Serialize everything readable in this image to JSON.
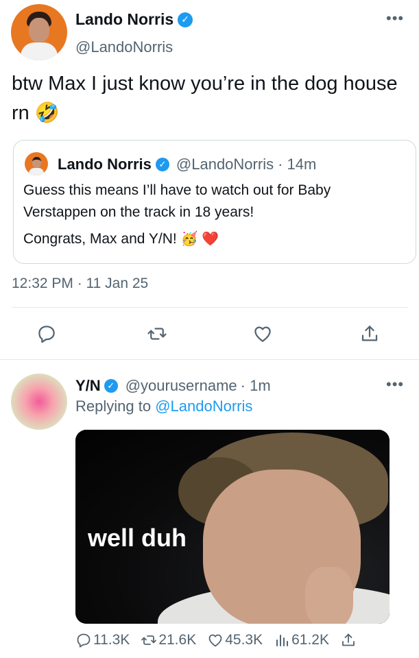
{
  "main_tweet": {
    "author_name": "Lando Norris",
    "author_handle": "@LandoNorris",
    "text": "btw Max I just know you’re in the dog house rn 🤣",
    "timestamp": "12:32 PM · 11 Jan 25"
  },
  "quoted_tweet": {
    "author_name": "Lando Norris",
    "author_handle": "@LandoNorris",
    "age": "· 14m",
    "line1": "Guess this means I’ll have to watch out for Baby Verstappen on the track in 18 years!",
    "line2": "Congrats, Max and Y/N!",
    "emojis": "🥳 ❤️"
  },
  "reply_tweet": {
    "author_name": "Y/N",
    "author_handle": "@yourusername",
    "age": "· 1m",
    "replying_prefix": "Replying to",
    "replying_to": "@LandoNorris",
    "media_caption": "well duh",
    "stats": {
      "replies": "11.3K",
      "retweets": "21.6K",
      "likes": "45.3K",
      "views": "61.2K"
    }
  },
  "icons": {
    "more": "more-horizontal-icon",
    "verified": "verified-badge-icon",
    "reply": "reply-icon",
    "retweet": "retweet-icon",
    "like": "heart-icon",
    "share": "share-icon",
    "views": "analytics-icon"
  },
  "colors": {
    "verified": "#1d9bf0",
    "link": "#1d9bf0",
    "muted_text": "#536471",
    "icon_gray": "#536471",
    "avatar_orange": "#e87722"
  }
}
